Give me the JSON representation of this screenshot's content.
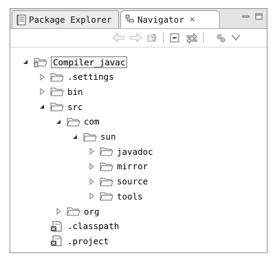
{
  "tabs": [
    {
      "label": "Package Explorer",
      "icon": "package-explorer-icon"
    },
    {
      "label": "Navigator",
      "icon": "navigator-icon",
      "close": "✕",
      "active": true
    }
  ],
  "toolbar": {
    "buttons": [
      "back-arrow-icon",
      "forward-arrow-icon",
      "up-folder-icon",
      "collapse-all-icon",
      "link-with-editor-icon",
      "settings-icon",
      "view-menu-icon"
    ]
  },
  "tree": [
    {
      "label": "Compiler_javac",
      "type": "project",
      "expanded": true,
      "depth": 0,
      "selected": true
    },
    {
      "label": ".settings",
      "type": "folder",
      "expanded": false,
      "depth": 1
    },
    {
      "label": "bin",
      "type": "folder",
      "expanded": false,
      "depth": 1
    },
    {
      "label": "src",
      "type": "folder",
      "expanded": true,
      "depth": 1
    },
    {
      "label": "com",
      "type": "folder",
      "expanded": true,
      "depth": 2
    },
    {
      "label": "sun",
      "type": "folder",
      "expanded": true,
      "depth": 3
    },
    {
      "label": "javadoc",
      "type": "folder",
      "expanded": false,
      "depth": 4
    },
    {
      "label": "mirror",
      "type": "folder",
      "expanded": false,
      "depth": 4
    },
    {
      "label": "source",
      "type": "folder",
      "expanded": false,
      "depth": 4
    },
    {
      "label": "tools",
      "type": "folder",
      "expanded": false,
      "depth": 4
    },
    {
      "label": "org",
      "type": "folder",
      "expanded": false,
      "depth": 2
    },
    {
      "label": ".classpath",
      "type": "file",
      "depth": 1
    },
    {
      "label": ".project",
      "type": "file",
      "depth": 1
    }
  ],
  "colors": {
    "folder_fill": "#f3f3f3",
    "folder_stroke": "#6f6f6f",
    "tab_bg": "#e4e4e4"
  }
}
